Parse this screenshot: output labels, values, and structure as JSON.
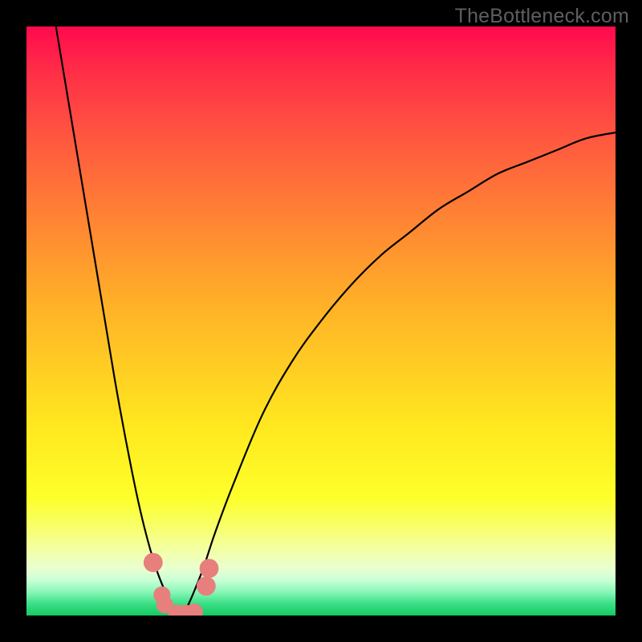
{
  "watermark": "TheBottleneck.com",
  "colors": {
    "frame": "#000000",
    "curve": "#000000",
    "marker": "#e7807c",
    "gradient_top": "#ff0a4d",
    "gradient_bottom": "#15c961"
  },
  "chart_data": {
    "type": "line",
    "title": "",
    "xlabel": "",
    "ylabel": "",
    "xlim": [
      0,
      100
    ],
    "ylim": [
      0,
      100
    ],
    "note": "V-shaped bottleneck curve. y represents mismatch percentage (0 = ideal, at bottom / green). Minimum of the curve is near x≈26. Axis ticks are not labeled; values are estimated from the shape.",
    "series": [
      {
        "name": "bottleneck-curve",
        "x": [
          5,
          10,
          15,
          18,
          20,
          22,
          24,
          25,
          26,
          27,
          28,
          30,
          32,
          35,
          40,
          45,
          50,
          55,
          60,
          65,
          70,
          75,
          80,
          85,
          90,
          95,
          100
        ],
        "y": [
          100,
          70,
          40,
          24,
          15,
          8,
          3,
          1,
          0,
          1,
          3,
          8,
          14,
          22,
          34,
          43,
          50,
          56,
          61,
          65,
          69,
          72,
          75,
          77,
          79,
          81,
          82
        ]
      }
    ],
    "markers": [
      {
        "x": 21.5,
        "y": 9,
        "r": 1.2
      },
      {
        "x": 23.0,
        "y": 3.5,
        "r": 1.0
      },
      {
        "x": 23.5,
        "y": 1.8,
        "r": 1.0
      },
      {
        "x": 25.5,
        "y": 0.4,
        "r": 1.0
      },
      {
        "x": 27.0,
        "y": 0.4,
        "r": 1.0
      },
      {
        "x": 28.5,
        "y": 0.6,
        "r": 1.0
      },
      {
        "x": 30.5,
        "y": 5.0,
        "r": 1.2
      },
      {
        "x": 31.0,
        "y": 8.0,
        "r": 1.2
      }
    ]
  }
}
